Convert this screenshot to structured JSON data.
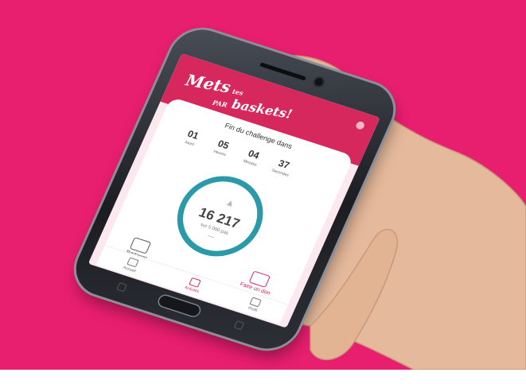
{
  "app": {
    "logo_line1": "Mets",
    "logo_line1_small": "tes",
    "logo_line2": "baskets!",
    "logo_tag": "PAR"
  },
  "challenge": {
    "title": "Fin du challenge dans",
    "timer": [
      {
        "value": "01",
        "label": "Jours"
      },
      {
        "value": "05",
        "label": "Heures"
      },
      {
        "value": "04",
        "label": "Minutes"
      },
      {
        "value": "37",
        "label": "Secondes"
      }
    ]
  },
  "steps": {
    "count": "16 217",
    "goal": "sur 5 000 pas",
    "dash": "—"
  },
  "actions": {
    "share_label": "Partager",
    "donate_label": "Faire un don"
  },
  "nav": {
    "items": [
      {
        "label": "Accueil",
        "active": false
      },
      {
        "label": "Activités",
        "active": true
      },
      {
        "label": "Profil",
        "active": false
      }
    ]
  },
  "colors": {
    "background": "#e81e6f",
    "brand": "#d6285d",
    "ring": "#2a9aa8"
  }
}
